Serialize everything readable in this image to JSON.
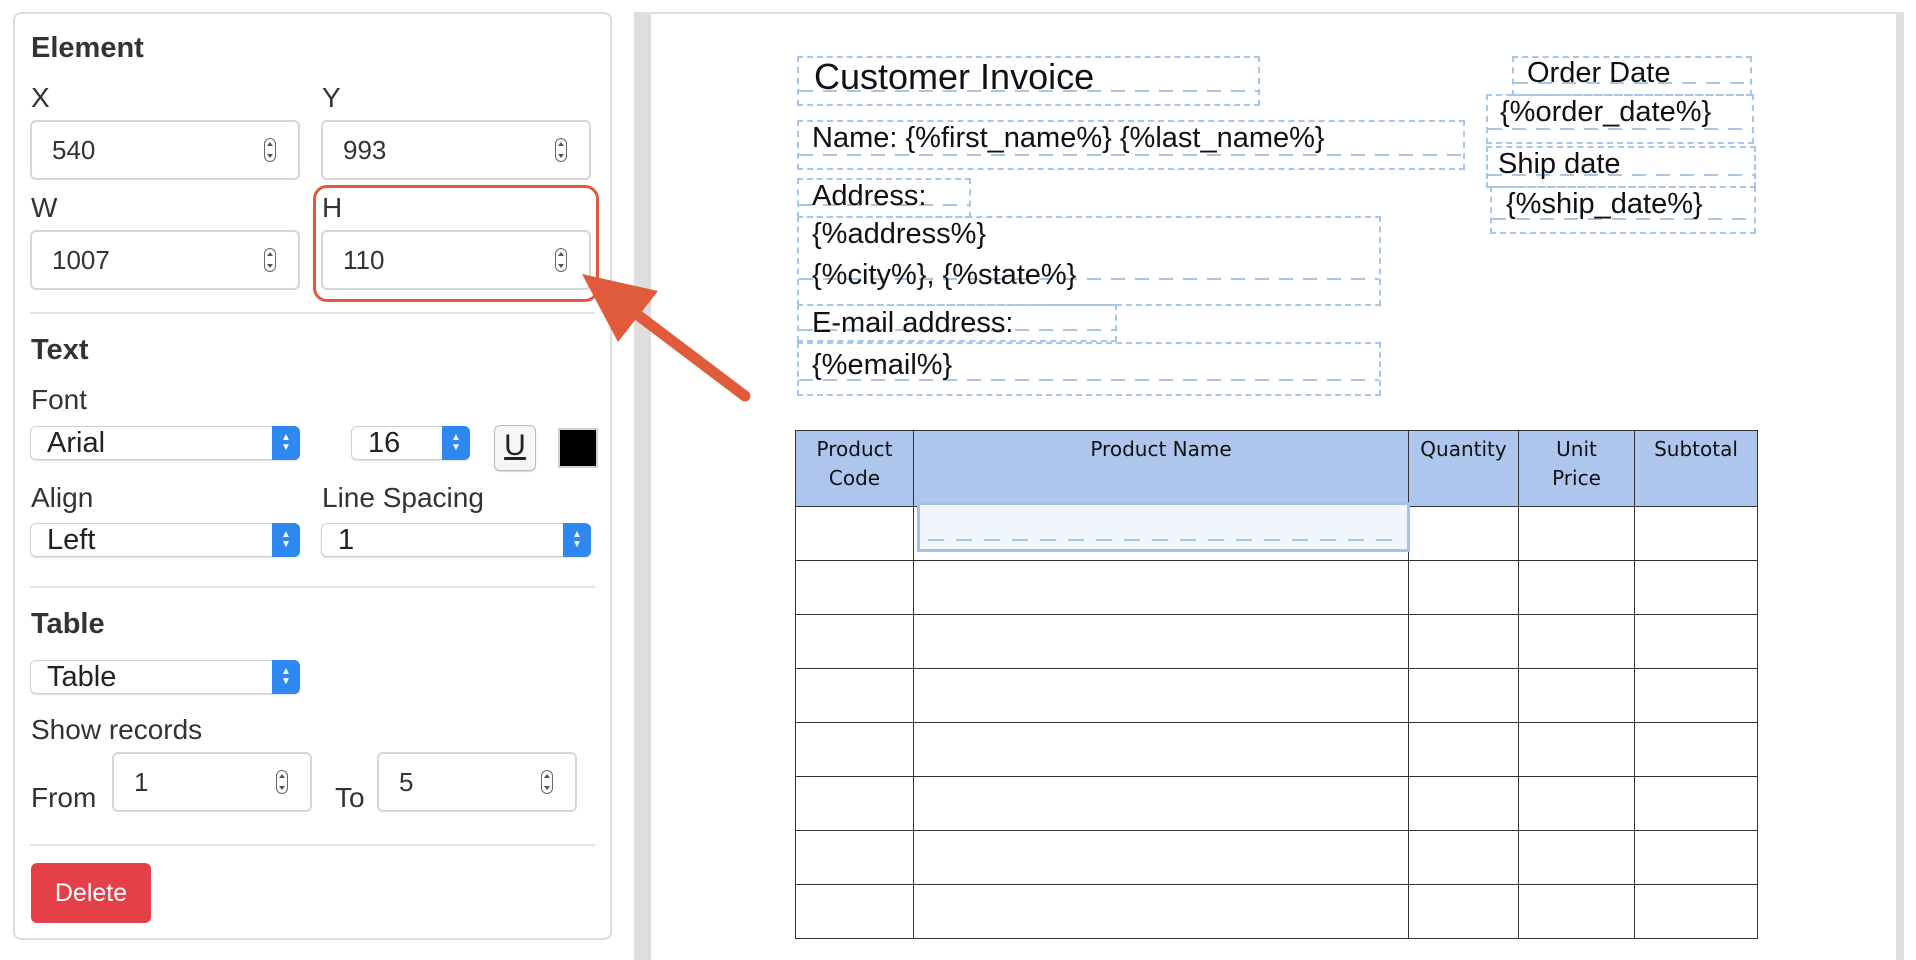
{
  "element": {
    "heading": "Element",
    "x_label": "X",
    "x_value": "540",
    "y_label": "Y",
    "y_value": "993",
    "w_label": "W",
    "w_value": "1007",
    "h_label": "H",
    "h_value": "110"
  },
  "text": {
    "heading": "Text",
    "font_label": "Font",
    "font_value": "Arial",
    "size_value": "16",
    "underline_label": "U",
    "color": "#000000",
    "align_label": "Align",
    "align_value": "Left",
    "line_spacing_label": "Line Spacing",
    "line_spacing_value": "1"
  },
  "table": {
    "heading": "Table",
    "type_value": "Table",
    "show_records_label": "Show records",
    "from_label": "From",
    "from_value": "1",
    "to_label": "To",
    "to_value": "5"
  },
  "delete_label": "Delete",
  "document": {
    "title": "Customer Invoice",
    "name_line": "Name: {%first_name%} {%last_name%}",
    "address_label": "Address:",
    "address_value": "{%address%}",
    "city_state": "{%city%}, {%state%}",
    "email_label": "E-mail address:",
    "email_value": "{%email%}",
    "order_date_label": "Order Date",
    "order_date_value": "{%order_date%}",
    "ship_date_label": "Ship date",
    "ship_date_value": "{%ship_date%}",
    "table_headers": [
      [
        "Product",
        "Code"
      ],
      [
        "Product Name"
      ],
      [
        "Quantity"
      ],
      [
        "Unit",
        "Price"
      ],
      [
        "Subtotal"
      ]
    ],
    "table_rows": 8
  },
  "colors": {
    "accent": "#2f87f0",
    "highlight": "#e05a3c",
    "delete": "#e5404a",
    "table_header": "#aec6ee",
    "placeholder_border": "#a8c6e6"
  },
  "icons": {
    "annotation_arrow": "arrow-pointing-to-height-field"
  }
}
